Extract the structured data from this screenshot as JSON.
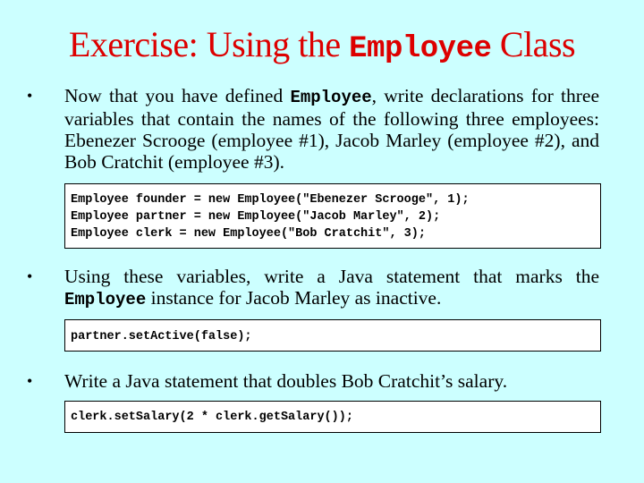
{
  "title": {
    "prefix": "Exercise: Using the ",
    "code": "Employee",
    "suffix": " Class"
  },
  "bullets": [
    {
      "before": "Now that you have defined ",
      "code": "Employee",
      "after": ", write declarations for three variables that contain the names of the following three employees: Ebenezer Scrooge (employee #1), Jacob Marley (employee #2), and Bob Cratchit (employee #3)."
    },
    {
      "before": "Using these variables, write a Java statement that marks the ",
      "code": "Employee",
      "after": " instance for Jacob Marley as inactive."
    },
    {
      "text": "Write a Java statement that doubles Bob Cratchit’s salary."
    }
  ],
  "code_blocks": [
    {
      "lines": [
        "Employee founder = new Employee(\"Ebenezer Scrooge\", 1);",
        "Employee partner = new Employee(\"Jacob Marley\", 2);",
        "Employee clerk = new Employee(\"Bob Cratchit\", 3);"
      ]
    },
    {
      "lines": [
        "partner.setActive(false);"
      ]
    },
    {
      "lines": [
        "clerk.setSalary(2 * clerk.getSalary());"
      ]
    }
  ],
  "bullet_glyph": "•",
  "colors": {
    "background": "#ccffff",
    "title": "#dd0000",
    "code_background": "#ffffff"
  }
}
